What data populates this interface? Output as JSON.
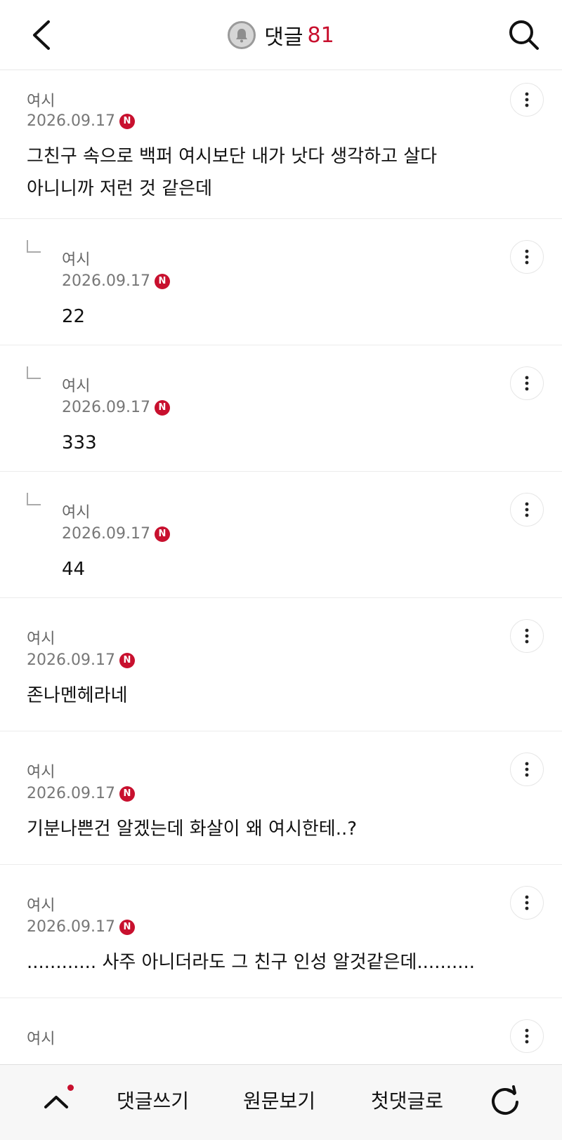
{
  "header": {
    "title": "댓글",
    "count": "81",
    "bell_icon": "bell-icon",
    "back_icon": "chevron-left-icon",
    "search_icon": "search-icon"
  },
  "comments": [
    {
      "author": "여시",
      "date": "2026.09.17",
      "badge": "N",
      "reply": false,
      "lines": [
        "그친구 속으로 백퍼 여시보단 내가 낫다 생각하고 살다",
        "아니니까 저런 것 같은데"
      ]
    },
    {
      "author": "여시",
      "date": "2026.09.17",
      "badge": "N",
      "reply": true,
      "lines": [
        "22"
      ]
    },
    {
      "author": "여시",
      "date": "2026.09.17",
      "badge": "N",
      "reply": true,
      "lines": [
        "333"
      ]
    },
    {
      "author": "여시",
      "date": "2026.09.17",
      "badge": "N",
      "reply": true,
      "lines": [
        "44"
      ]
    },
    {
      "author": "여시",
      "date": "2026.09.17",
      "badge": "N",
      "reply": false,
      "lines": [
        "존나멘헤라네"
      ]
    },
    {
      "author": "여시",
      "date": "2026.09.17",
      "badge": "N",
      "reply": false,
      "lines": [
        "기분나쁜건 알겠는데 화살이 왜 여시한테..?"
      ]
    },
    {
      "author": "여시",
      "date": "2026.09.17",
      "badge": "N",
      "reply": false,
      "lines": [
        "............ 사주 아니더라도 그 친구 인성 알것같은데.........."
      ]
    },
    {
      "author": "여시",
      "date": "",
      "badge": "",
      "reply": false,
      "lines": []
    }
  ],
  "bottom_bar": {
    "up_icon": "chevron-up-icon",
    "write": "댓글쓰기",
    "original": "원문보기",
    "first": "첫댓글로",
    "refresh_icon": "refresh-icon"
  },
  "colors": {
    "accent": "#c8102e",
    "meta_text": "#777777",
    "divider": "#ececec"
  }
}
